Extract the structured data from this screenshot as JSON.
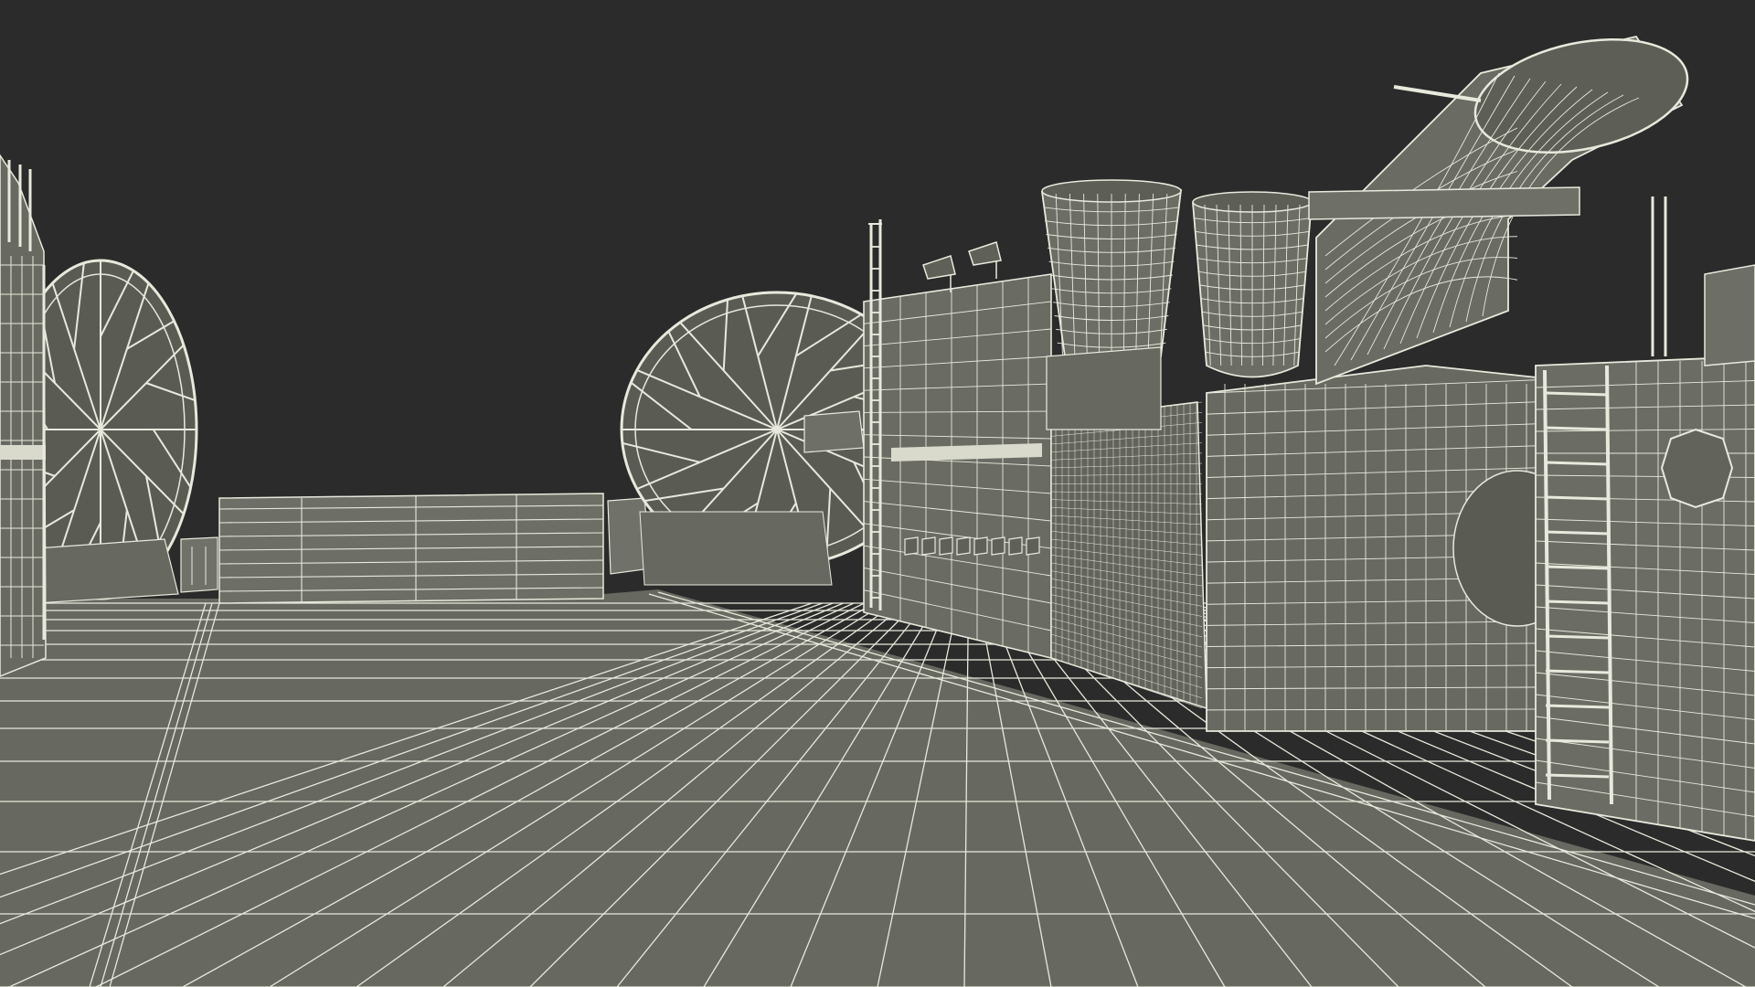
{
  "scene": {
    "subject": "hovercraft-deck-wireframe",
    "render_style": "wireframe",
    "colors": {
      "background": "#2b2b2b",
      "surface": "#676960",
      "surface_dark": "#585a52",
      "surface_light": "#77796f",
      "wire": "#e8e9dc",
      "wire_dim": "#c9cabd"
    },
    "objects": [
      "left-fan-shroud",
      "left-superstructure",
      "rear-ramp-gate",
      "center-fan-shroud",
      "engine-block",
      "left-exhaust-stack",
      "right-exhaust-stack",
      "air-intake-scoop",
      "plenum-chamber",
      "access-ladder",
      "right-hull-panel",
      "deck-floor"
    ]
  }
}
